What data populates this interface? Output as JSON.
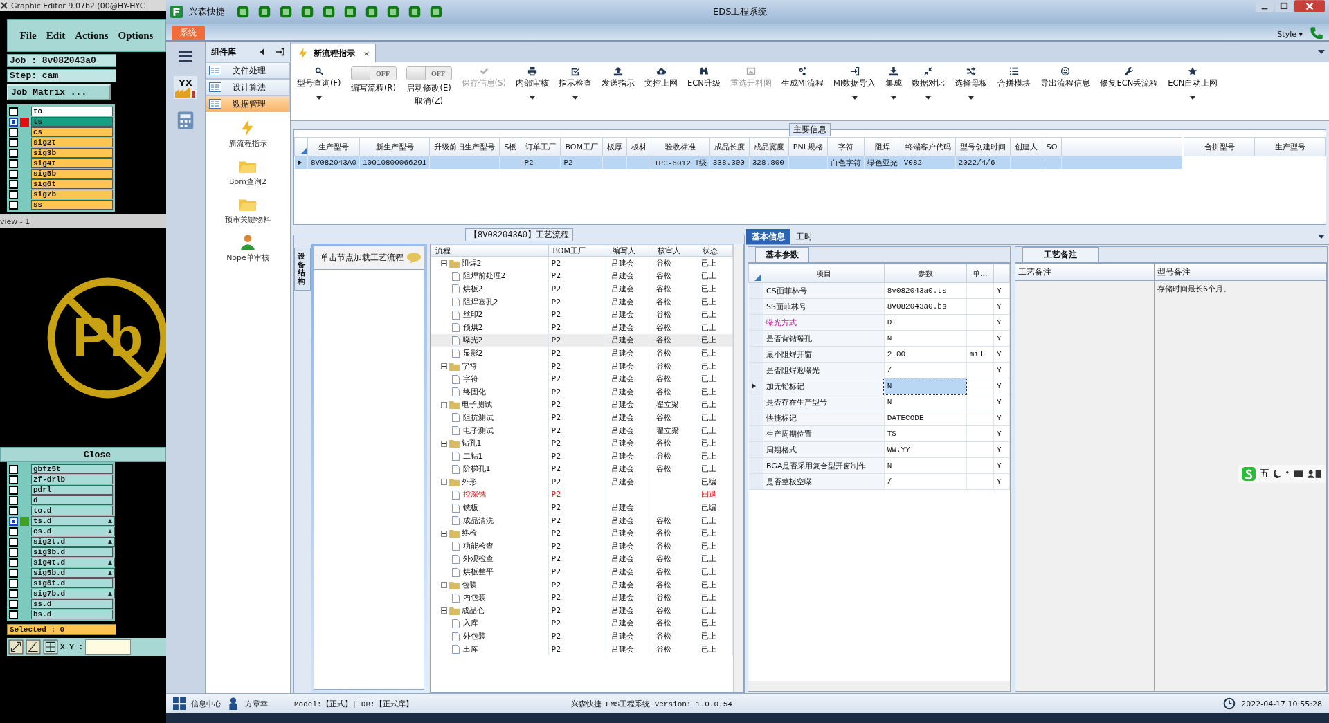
{
  "editor": {
    "title": "Graphic Editor 9.07b2 (00@HY-HYC",
    "menu": [
      "File",
      "Edit",
      "Actions",
      "Options"
    ],
    "job": "Job : 8v082043a0",
    "step": "Step: cam",
    "matrix_button": "Job Matrix ...",
    "layers": [
      {
        "name": "to",
        "color": "#ffffff",
        "active": false
      },
      {
        "name": "ts",
        "color": "#16a083",
        "active": true
      },
      {
        "name": "cs",
        "color": "#ffc552",
        "active": false
      },
      {
        "name": "sig2t",
        "color": "#ffc552",
        "active": false
      },
      {
        "name": "sig3b",
        "color": "#ffc552",
        "active": false
      },
      {
        "name": "sig4t",
        "color": "#ffc552",
        "active": false
      },
      {
        "name": "sig5b",
        "color": "#ffc552",
        "active": false
      },
      {
        "name": "sig6t",
        "color": "#ffc552",
        "active": false
      },
      {
        "name": "sig7b",
        "color": "#ffc552",
        "active": false
      },
      {
        "name": "ss",
        "color": "#ffc552",
        "active": false
      }
    ],
    "preview_title": "view - 1",
    "preview_logo_text": "Pb",
    "close_button": "Close",
    "steps": [
      {
        "name": "gbfz5t",
        "marked": false,
        "edited": false
      },
      {
        "name": "zf-drlb",
        "marked": false,
        "edited": false
      },
      {
        "name": "pdrl",
        "marked": false,
        "edited": false
      },
      {
        "name": "d",
        "marked": false,
        "edited": false
      },
      {
        "name": "to.d",
        "marked": false,
        "edited": false
      },
      {
        "name": "ts.d",
        "marked": true,
        "edited": true
      },
      {
        "name": "cs.d",
        "marked": false,
        "edited": true
      },
      {
        "name": "sig2t.d",
        "marked": false,
        "edited": true
      },
      {
        "name": "sig3b.d",
        "marked": false,
        "edited": false
      },
      {
        "name": "sig4t.d",
        "marked": false,
        "edited": true
      },
      {
        "name": "sig5b.d",
        "marked": false,
        "edited": true
      },
      {
        "name": "sig6t.d",
        "marked": false,
        "edited": false
      },
      {
        "name": "sig7b.d",
        "marked": false,
        "edited": true
      },
      {
        "name": "ss.d",
        "marked": false,
        "edited": false
      },
      {
        "name": "bs.d",
        "marked": false,
        "edited": false
      }
    ],
    "selected_count": "Selected : 0",
    "xy_label": "X Y :"
  },
  "window": {
    "brand": "兴森快捷",
    "title": "EDS工程系统",
    "menu_tab": "系统",
    "style_menu": "Style",
    "style_caret": "▾"
  },
  "rail": {
    "logo_text": "YX"
  },
  "sidebar": {
    "title": "组件库",
    "items": [
      {
        "label": "文件处理",
        "selected": false
      },
      {
        "label": "设计算法",
        "selected": false
      },
      {
        "label": "数据管理",
        "selected": true
      }
    ],
    "modules": [
      "新流程指示",
      "Bom查询2",
      "预审关键物料",
      "Nope单审核"
    ]
  },
  "doc_tab": {
    "label": "新流程指示",
    "close": "×"
  },
  "toolbar": {
    "items": [
      {
        "kind": "button",
        "label": "型号查询(F)",
        "disabled": false,
        "dropdown": true
      },
      {
        "kind": "switch",
        "label": "编写流程(R)",
        "state_text": "OFF",
        "on": false
      },
      {
        "kind": "switch",
        "label": "启动修改(E)",
        "label2": "取消(Z)",
        "state_text": "OFF",
        "on": false
      },
      {
        "kind": "button",
        "label": "保存信息(S)",
        "disabled": true,
        "dropdown": false
      },
      {
        "kind": "button",
        "label": "内部审核",
        "disabled": false,
        "dropdown": true
      },
      {
        "kind": "button",
        "label": "指示检查",
        "disabled": false,
        "dropdown": true
      },
      {
        "kind": "button",
        "label": "发送指示",
        "disabled": false,
        "dropdown": false
      },
      {
        "kind": "button",
        "label": "文控上网",
        "disabled": false,
        "dropdown": false
      },
      {
        "kind": "button",
        "label": "ECN升级",
        "disabled": false,
        "dropdown": false
      },
      {
        "kind": "button",
        "label": "重选开料图",
        "disabled": true,
        "dropdown": false
      },
      {
        "kind": "button",
        "label": "生成MI流程",
        "disabled": false,
        "dropdown": false
      },
      {
        "kind": "button",
        "label": "MI数据导入",
        "disabled": false,
        "dropdown": true
      },
      {
        "kind": "button",
        "label": "集成",
        "disabled": false,
        "dropdown": true
      },
      {
        "kind": "button",
        "label": "数据对比",
        "disabled": false,
        "dropdown": true
      },
      {
        "kind": "button",
        "label": "选择母板",
        "disabled": false,
        "dropdown": true
      },
      {
        "kind": "button",
        "label": "合拼模块",
        "disabled": false,
        "dropdown": false
      },
      {
        "kind": "button",
        "label": "导出流程信息",
        "disabled": false,
        "dropdown": false
      },
      {
        "kind": "button",
        "label": "修复ECN丢流程",
        "disabled": false,
        "dropdown": false
      },
      {
        "kind": "button",
        "label": "ECN自动上网",
        "disabled": false,
        "dropdown": true
      }
    ]
  },
  "main_info": {
    "title": "主要信息",
    "columns": [
      "生产型号",
      "新生产型号",
      "升级前旧生产型号",
      "S板",
      "订单工厂",
      "BOM工厂",
      "板厚",
      "板材",
      "验收标准",
      "成品长度",
      "成品宽度",
      "PNL规格",
      "字符",
      "阻焊",
      "终端客户代码",
      "型号创建时间",
      "创建人",
      "SO"
    ],
    "rows": [
      {
        "selected": true,
        "cells": [
          "8V082043A0",
          "10010800066291",
          null,
          null,
          "P2",
          "P2",
          null,
          null,
          "IPC-6012 Ⅱ级",
          "338.300",
          "328.800",
          null,
          "白色字符",
          "绿色亚光",
          "V082",
          "2022/4/6",
          null,
          null
        ]
      }
    ],
    "side_columns": [
      "合拼型号",
      "生产型号"
    ]
  },
  "process": {
    "side_tab": "设备结构",
    "hint": "单击节点加载工艺流程",
    "title": "【8V082043A0】工艺流程",
    "columns": [
      "流程",
      "BOM工厂",
      "编写人",
      "核审人",
      "状态"
    ],
    "tree": [
      {
        "name": "阻焊2",
        "bom": "P2",
        "writer": "吕建会",
        "reviewer": "谷松",
        "status": "已上",
        "expanded": true,
        "children": [
          {
            "name": "阻焊前处理2",
            "bom": "P2",
            "writer": "吕建会",
            "reviewer": "谷松",
            "status": "已上",
            "selected": false,
            "returned": false
          },
          {
            "name": "烘板2",
            "bom": "P2",
            "writer": "吕建会",
            "reviewer": "谷松",
            "status": "已上",
            "selected": false,
            "returned": false
          },
          {
            "name": "阻焊塞孔2",
            "bom": "P2",
            "writer": "吕建会",
            "reviewer": "谷松",
            "status": "已上",
            "selected": false,
            "returned": false
          },
          {
            "name": "丝印2",
            "bom": "P2",
            "writer": "吕建会",
            "reviewer": "谷松",
            "status": "已上",
            "selected": false,
            "returned": false
          },
          {
            "name": "预烘2",
            "bom": "P2",
            "writer": "吕建会",
            "reviewer": "谷松",
            "status": "已上",
            "selected": false,
            "returned": false
          },
          {
            "name": "曝光2",
            "bom": "P2",
            "writer": "吕建会",
            "reviewer": "谷松",
            "status": "已上",
            "selected": true,
            "returned": false
          },
          {
            "name": "显影2",
            "bom": "P2",
            "writer": "吕建会",
            "reviewer": "谷松",
            "status": "已上",
            "selected": false,
            "returned": false
          }
        ]
      },
      {
        "name": "字符",
        "bom": "P2",
        "writer": "吕建会",
        "reviewer": "谷松",
        "status": "已上",
        "expanded": true,
        "children": [
          {
            "name": "字符",
            "bom": "P2",
            "writer": "吕建会",
            "reviewer": "谷松",
            "status": "已上",
            "selected": false,
            "returned": false
          },
          {
            "name": "终固化",
            "bom": "P2",
            "writer": "吕建会",
            "reviewer": "谷松",
            "status": "已上",
            "selected": false,
            "returned": false
          }
        ]
      },
      {
        "name": "电子测试",
        "bom": "P2",
        "writer": "吕建会",
        "reviewer": "翟立梁",
        "status": "已上",
        "expanded": true,
        "children": [
          {
            "name": "阻抗测试",
            "bom": "P2",
            "writer": "吕建会",
            "reviewer": "谷松",
            "status": "已上",
            "selected": false,
            "returned": false
          },
          {
            "name": "电子测试",
            "bom": "P2",
            "writer": "吕建会",
            "reviewer": "翟立梁",
            "status": "已上",
            "selected": false,
            "returned": false
          }
        ]
      },
      {
        "name": "钻孔1",
        "bom": "P2",
        "writer": "吕建会",
        "reviewer": "谷松",
        "status": "已上",
        "expanded": true,
        "children": [
          {
            "name": "二钻1",
            "bom": "P2",
            "writer": "吕建会",
            "reviewer": "谷松",
            "status": "已上",
            "selected": false,
            "returned": false
          },
          {
            "name": "阶梯孔1",
            "bom": "P2",
            "writer": "吕建会",
            "reviewer": "谷松",
            "status": "已上",
            "selected": false,
            "returned": false
          }
        ]
      },
      {
        "name": "外形",
        "bom": "P2",
        "writer": "吕建会",
        "status": "已编",
        "expanded": true,
        "children": [
          {
            "name": "控深铣",
            "bom": "P2",
            "status": "回退",
            "selected": false,
            "returned": true
          },
          {
            "name": "铣板",
            "bom": "P2",
            "writer": "吕建会",
            "status": "已编",
            "selected": false,
            "returned": false
          },
          {
            "name": "成品清洗",
            "bom": "P2",
            "writer": "吕建会",
            "reviewer": "谷松",
            "status": "已上",
            "selected": false,
            "returned": false
          }
        ]
      },
      {
        "name": "终检",
        "bom": "P2",
        "writer": "吕建会",
        "reviewer": "谷松",
        "status": "已上",
        "expanded": true,
        "children": [
          {
            "name": "功能检查",
            "bom": "P2",
            "writer": "吕建会",
            "reviewer": "谷松",
            "status": "已上",
            "selected": false,
            "returned": false
          },
          {
            "name": "外观检查",
            "bom": "P2",
            "writer": "吕建会",
            "reviewer": "谷松",
            "status": "已上",
            "selected": false,
            "returned": false
          },
          {
            "name": "烘板整平",
            "bom": "P2",
            "writer": "吕建会",
            "reviewer": "谷松",
            "status": "已上",
            "selected": false,
            "returned": false
          }
        ]
      },
      {
        "name": "包装",
        "bom": "P2",
        "writer": "吕建会",
        "reviewer": "谷松",
        "status": "已上",
        "expanded": true,
        "children": [
          {
            "name": "内包装",
            "bom": "P2",
            "writer": "吕建会",
            "reviewer": "谷松",
            "status": "已上",
            "selected": false,
            "returned": false
          }
        ]
      },
      {
        "name": "成品仓",
        "bom": "P2",
        "writer": "吕建会",
        "reviewer": "谷松",
        "status": "已上",
        "expanded": true,
        "children": [
          {
            "name": "入库",
            "bom": "P2",
            "writer": "吕建会",
            "reviewer": "谷松",
            "status": "已上",
            "selected": false,
            "returned": false
          },
          {
            "name": "外包装",
            "bom": "P2",
            "writer": "吕建会",
            "reviewer": "谷松",
            "status": "已上",
            "selected": false,
            "returned": false
          },
          {
            "name": "出库",
            "bom": "P2",
            "writer": "吕建会",
            "reviewer": "谷松",
            "status": "已上",
            "selected": false,
            "returned": false
          }
        ]
      }
    ]
  },
  "detail_tabs": [
    {
      "label": "基本信息",
      "selected": true
    },
    {
      "label": "工时",
      "selected": false
    }
  ],
  "params": {
    "tab": "基本参数",
    "columns": [
      "项目",
      "参数",
      "单..."
    ],
    "rows": [
      {
        "name": "CS面菲林号",
        "value": "8v082043a0.ts",
        "unit": null,
        "flag": "Y",
        "emphasis": false,
        "selected": false
      },
      {
        "name": "SS面菲林号",
        "value": "8v082043a0.bs",
        "unit": null,
        "flag": "Y",
        "emphasis": false,
        "selected": false
      },
      {
        "name": "曝光方式",
        "value": "DI",
        "unit": null,
        "flag": "Y",
        "emphasis": true,
        "selected": false
      },
      {
        "name": "是否背钻曝孔",
        "value": "N",
        "unit": null,
        "flag": "Y",
        "emphasis": false,
        "selected": false
      },
      {
        "name": "最小阻焊开窗",
        "value": "2.00",
        "unit": "mil",
        "flag": "Y",
        "emphasis": false,
        "selected": false
      },
      {
        "name": "是否阻焊返曝光",
        "value": "/",
        "unit": null,
        "flag": "Y",
        "emphasis": false,
        "selected": false
      },
      {
        "name": "加无铅标记",
        "value": "N",
        "unit": null,
        "flag": "Y",
        "emphasis": false,
        "selected": true
      },
      {
        "name": "是否存在生产型号",
        "value": "N",
        "unit": null,
        "flag": "Y",
        "emphasis": false,
        "selected": false
      },
      {
        "name": "快捷标记",
        "value": "DATECODE",
        "unit": null,
        "flag": "Y",
        "emphasis": false,
        "selected": false
      },
      {
        "name": "生产周期位置",
        "value": "TS",
        "unit": null,
        "flag": "Y",
        "emphasis": false,
        "selected": false
      },
      {
        "name": "周期格式",
        "value": "WW.YY",
        "unit": null,
        "flag": "Y",
        "emphasis": false,
        "selected": false
      },
      {
        "name": "BGA是否采用复合型开窗制作",
        "value": "N",
        "unit": null,
        "flag": "Y",
        "emphasis": false,
        "selected": false
      },
      {
        "name": "是否整板空曝",
        "value": "/",
        "unit": null,
        "flag": "Y",
        "emphasis": false,
        "selected": false
      }
    ]
  },
  "notes": {
    "tab": "工艺备注",
    "columns": [
      "工艺备注",
      "型号备注"
    ],
    "model_note": "存储时间最长6个月。"
  },
  "ime_bar": {
    "mode": "五"
  },
  "status_bar": {
    "info_center": "信息中心",
    "user": "方章幸",
    "model": "Model:【正式】||DB:【正式库】",
    "version": "兴森快捷 EMS工程系统 Version: 1.0.0.54",
    "datetime": "2022-04-17 10:55:28"
  }
}
